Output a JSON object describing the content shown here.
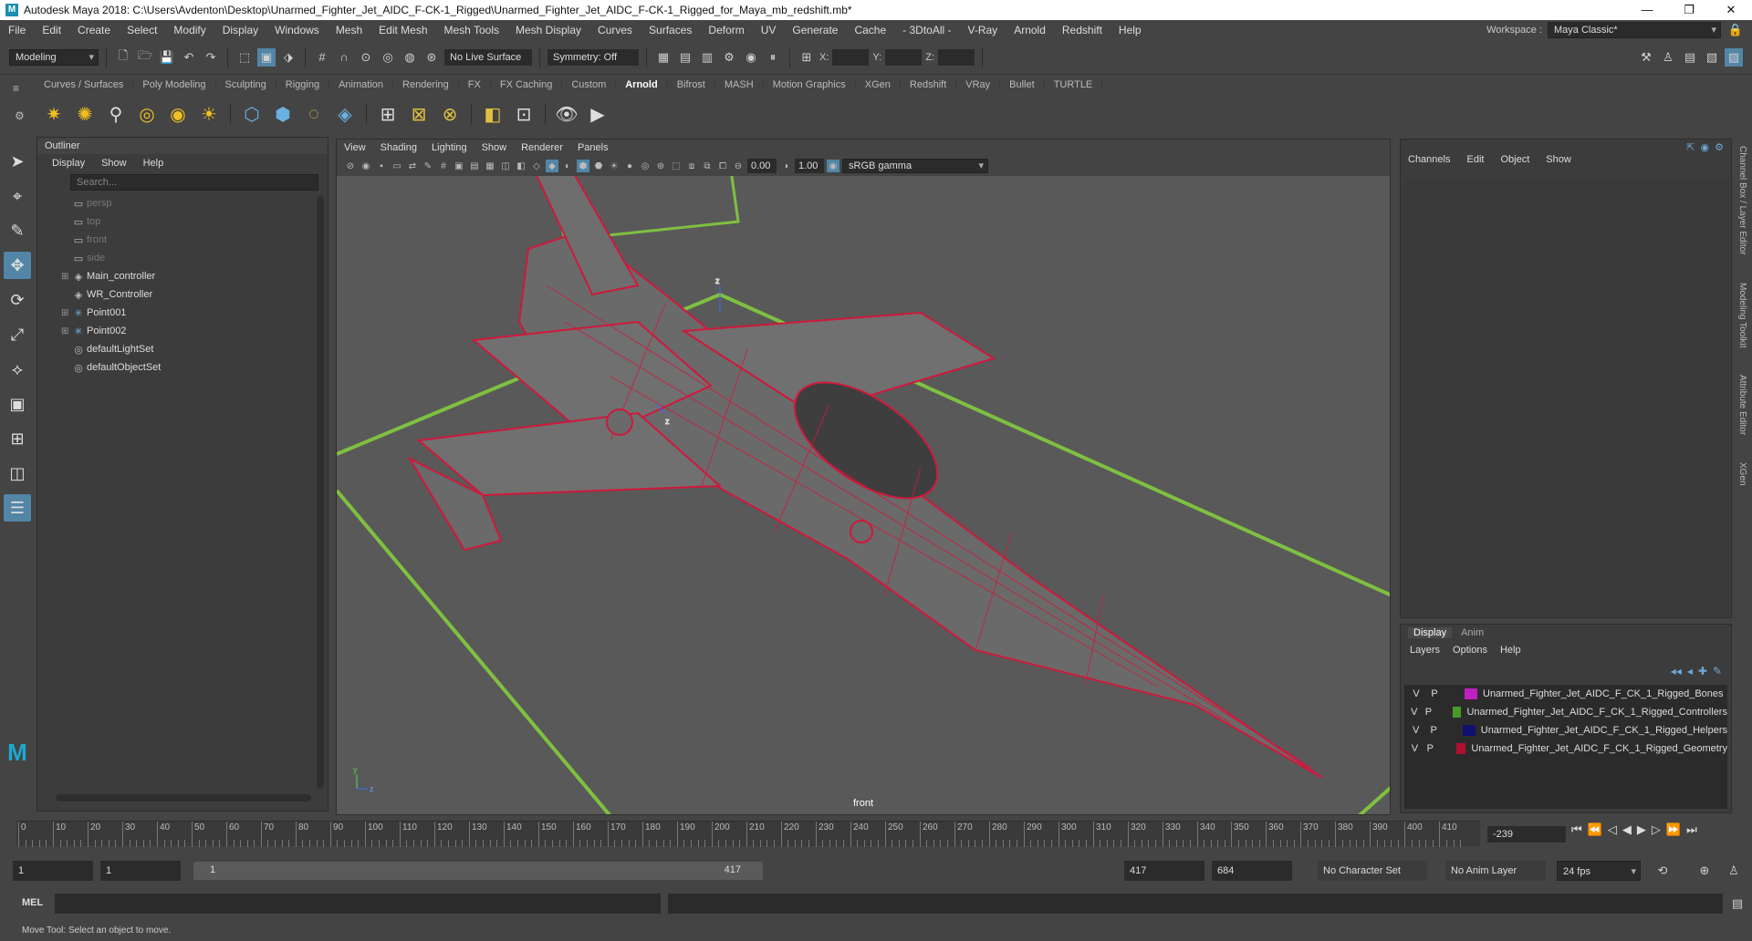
{
  "title_bar": {
    "title": "Autodesk Maya 2018: C:\\Users\\Avdenton\\Desktop\\Unarmed_Fighter_Jet_AIDC_F-CK-1_Rigged\\Unarmed_Fighter_Jet_AIDC_F-CK-1_Rigged_for_Maya_mb_redshift.mb*",
    "minimize": "—",
    "maximize": "❐",
    "close": "✕"
  },
  "menu_bar": {
    "items": [
      "File",
      "Edit",
      "Create",
      "Select",
      "Modify",
      "Display",
      "Windows",
      "Mesh",
      "Edit Mesh",
      "Mesh Tools",
      "Mesh Display",
      "Curves",
      "Surfaces",
      "Deform",
      "UV",
      "Generate",
      "Cache",
      "- 3DtoAll -",
      "V-Ray",
      "Arnold",
      "Redshift",
      "Help"
    ],
    "workspace_label": "Workspace :",
    "workspace_value": "Maya Classic*"
  },
  "status_line": {
    "mode": "Modeling",
    "live_surface": "No Live Surface",
    "symmetry": "Symmetry: Off",
    "x_label": "X:",
    "y_label": "Y:",
    "z_label": "Z:"
  },
  "shelf": {
    "tabs": [
      "Curves / Surfaces",
      "Poly Modeling",
      "Sculpting",
      "Rigging",
      "Animation",
      "Rendering",
      "FX",
      "FX Caching",
      "Custom",
      "Arnold",
      "Bifrost",
      "MASH",
      "Motion Graphics",
      "XGen",
      "Redshift",
      "VRay",
      "Bullet",
      "TURTLE"
    ],
    "active_tab": "Arnold"
  },
  "outliner": {
    "title": "Outliner",
    "menu": [
      "Display",
      "Show",
      "Help"
    ],
    "search_placeholder": "Search...",
    "items": [
      {
        "label": "persp",
        "dim": true,
        "expand": ""
      },
      {
        "label": "top",
        "dim": true,
        "expand": ""
      },
      {
        "label": "front",
        "dim": true,
        "expand": ""
      },
      {
        "label": "side",
        "dim": true,
        "expand": ""
      },
      {
        "label": "Main_controller",
        "dim": false,
        "expand": "⊞"
      },
      {
        "label": "WR_Controller",
        "dim": false,
        "expand": ""
      },
      {
        "label": "Point001",
        "dim": false,
        "expand": "⊞"
      },
      {
        "label": "Point002",
        "dim": false,
        "expand": "⊞"
      },
      {
        "label": "defaultLightSet",
        "dim": false,
        "expand": ""
      },
      {
        "label": "defaultObjectSet",
        "dim": false,
        "expand": ""
      }
    ]
  },
  "viewport": {
    "menu": [
      "View",
      "Shading",
      "Lighting",
      "Show",
      "Renderer",
      "Panels"
    ],
    "exposure": "0.00",
    "gamma": "1.00",
    "color_space": "sRGB gamma",
    "camera_label": "front"
  },
  "channel_box": {
    "menu": [
      "Channels",
      "Edit",
      "Object",
      "Show"
    ],
    "side_tabs": [
      "Channel Box / Layer Editor",
      "Modeling Toolkit",
      "Attribute Editor",
      "XGen"
    ]
  },
  "layer_editor": {
    "tabs": [
      "Display",
      "Anim"
    ],
    "menu": [
      "Layers",
      "Options",
      "Help"
    ],
    "layers": [
      {
        "v": "V",
        "p": "P",
        "name": "Unarmed_Fighter_Jet_AIDC_F_CK_1_Rigged_Bones",
        "color": "#c020c0"
      },
      {
        "v": "V",
        "p": "P",
        "name": "Unarmed_Fighter_Jet_AIDC_F_CK_1_Rigged_Controllers",
        "color": "#4a9a2a"
      },
      {
        "v": "V",
        "p": "P",
        "name": "Unarmed_Fighter_Jet_AIDC_F_CK_1_Rigged_Helpers",
        "color": "#101070"
      },
      {
        "v": "V",
        "p": "P",
        "name": "Unarmed_Fighter_Jet_AIDC_F_CK_1_Rigged_Geometry",
        "color": "#b01030"
      }
    ]
  },
  "timeline": {
    "ticks": [
      "0",
      "10",
      "20",
      "30",
      "40",
      "50",
      "60",
      "70",
      "80",
      "90",
      "100",
      "110",
      "120",
      "130",
      "140",
      "150",
      "160",
      "170",
      "180",
      "190",
      "200",
      "210",
      "220",
      "230",
      "240",
      "250",
      "260",
      "270",
      "280",
      "290",
      "300",
      "310",
      "320",
      "330",
      "340",
      "350",
      "360",
      "370",
      "380",
      "390",
      "400",
      "410"
    ],
    "current_frame": "-239"
  },
  "range_slider": {
    "start": "1",
    "playback_start": "1",
    "range_start": "1",
    "range_end": "417",
    "playback_end": "417",
    "end": "684",
    "character_set": "No Character Set",
    "anim_layer": "No Anim Layer",
    "fps": "24 fps"
  },
  "command_line": {
    "label": "MEL"
  },
  "help_line": {
    "text": "Move Tool: Select an object to move."
  },
  "colors": {
    "wire": "#d0183c",
    "controller": "#7fc040",
    "accent": "#5285a6"
  }
}
